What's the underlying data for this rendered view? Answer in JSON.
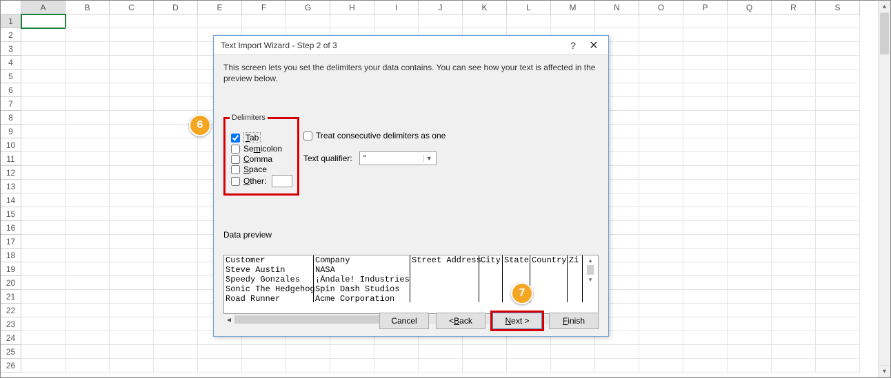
{
  "columns": [
    "A",
    "B",
    "C",
    "D",
    "E",
    "F",
    "G",
    "H",
    "I",
    "J",
    "K",
    "L",
    "M",
    "N",
    "O",
    "P",
    "Q",
    "R",
    "S"
  ],
  "row_count": 26,
  "selected_cell": {
    "row": 1,
    "col": "A"
  },
  "dialog": {
    "title": "Text Import Wizard - Step 2 of 3",
    "instruction": "This screen lets you set the delimiters your data contains.  You can see how your text is affected in the preview below.",
    "delimiters_label": "Delimiters",
    "delimiters": {
      "tab": {
        "label": "Tab",
        "checked": true
      },
      "semicolon": {
        "label": "Semicolon",
        "checked": false
      },
      "comma": {
        "label": "Comma",
        "checked": false
      },
      "space": {
        "label": "Space",
        "checked": false
      },
      "other": {
        "label": "Other:",
        "checked": false,
        "value": ""
      }
    },
    "treat_consecutive": {
      "label": "Treat consecutive delimiters as one",
      "checked": false
    },
    "text_qualifier": {
      "label": "Text qualifier:",
      "value": "\""
    },
    "preview_label": "Data preview",
    "preview_columns": [
      "Customer",
      "Company",
      "Street Address",
      "City",
      "State",
      "Country",
      "Zi"
    ],
    "preview_rows": [
      [
        "Steve Austin",
        "NASA",
        "",
        "",
        "",
        "",
        ""
      ],
      [
        "Speedy Gonzales",
        "¡Ándale! Industries",
        "",
        "",
        "",
        "",
        ""
      ],
      [
        "Sonic The Hedgehog",
        "Spin Dash Studios",
        "",
        "",
        "",
        "",
        ""
      ],
      [
        "Road Runner",
        "Acme Corporation",
        "",
        "",
        "",
        "",
        ""
      ]
    ],
    "buttons": {
      "cancel": "Cancel",
      "back": "< Back",
      "next": "Next >",
      "finish": "Finish"
    }
  },
  "callouts": {
    "six": "6",
    "seven": "7"
  }
}
